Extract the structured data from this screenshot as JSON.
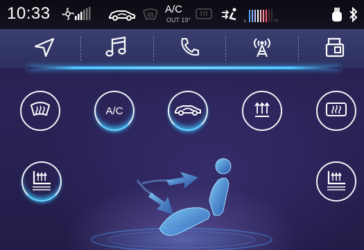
{
  "status_bar": {
    "time": "10:33",
    "ac_label": "A/C",
    "outside_temp": "OUT  19°",
    "icons": [
      "fan-speed-icon",
      "car-recirculation-icon",
      "windshield-defrost-icon",
      "ac-icon",
      "rear-defrost-icon",
      "airflow-direction-icon",
      "temperature-level-icon",
      "usb-icon",
      "bluetooth-icon"
    ]
  },
  "nav": {
    "items": [
      {
        "name": "navigation",
        "icon": "navigation-arrow-icon"
      },
      {
        "name": "media",
        "icon": "music-note-icon"
      },
      {
        "name": "phone",
        "icon": "phone-icon"
      },
      {
        "name": "radio",
        "icon": "radio-tower-icon"
      },
      {
        "name": "apps",
        "icon": "apps-icon"
      }
    ]
  },
  "climate": {
    "ac_button_label": "A/C",
    "buttons": [
      {
        "name": "front-defrost",
        "icon": "front-defrost-icon",
        "active": false
      },
      {
        "name": "ac",
        "icon": "ac-icon",
        "active": true
      },
      {
        "name": "recirculation",
        "icon": "car-recirculation-icon",
        "active": true
      },
      {
        "name": "max-heat",
        "icon": "max-heat-icon",
        "active": false
      },
      {
        "name": "rear-defrost",
        "icon": "rear-defrost-icon",
        "active": false
      },
      {
        "name": "left-seat-heat",
        "icon": "seat-heat-icon",
        "active": true
      },
      {
        "name": "right-seat-heat",
        "icon": "seat-heat-icon",
        "active": false
      }
    ]
  },
  "colors": {
    "accent": "#3ec5ff",
    "background": "#2a2356",
    "status_bar": "#0b0b12"
  }
}
